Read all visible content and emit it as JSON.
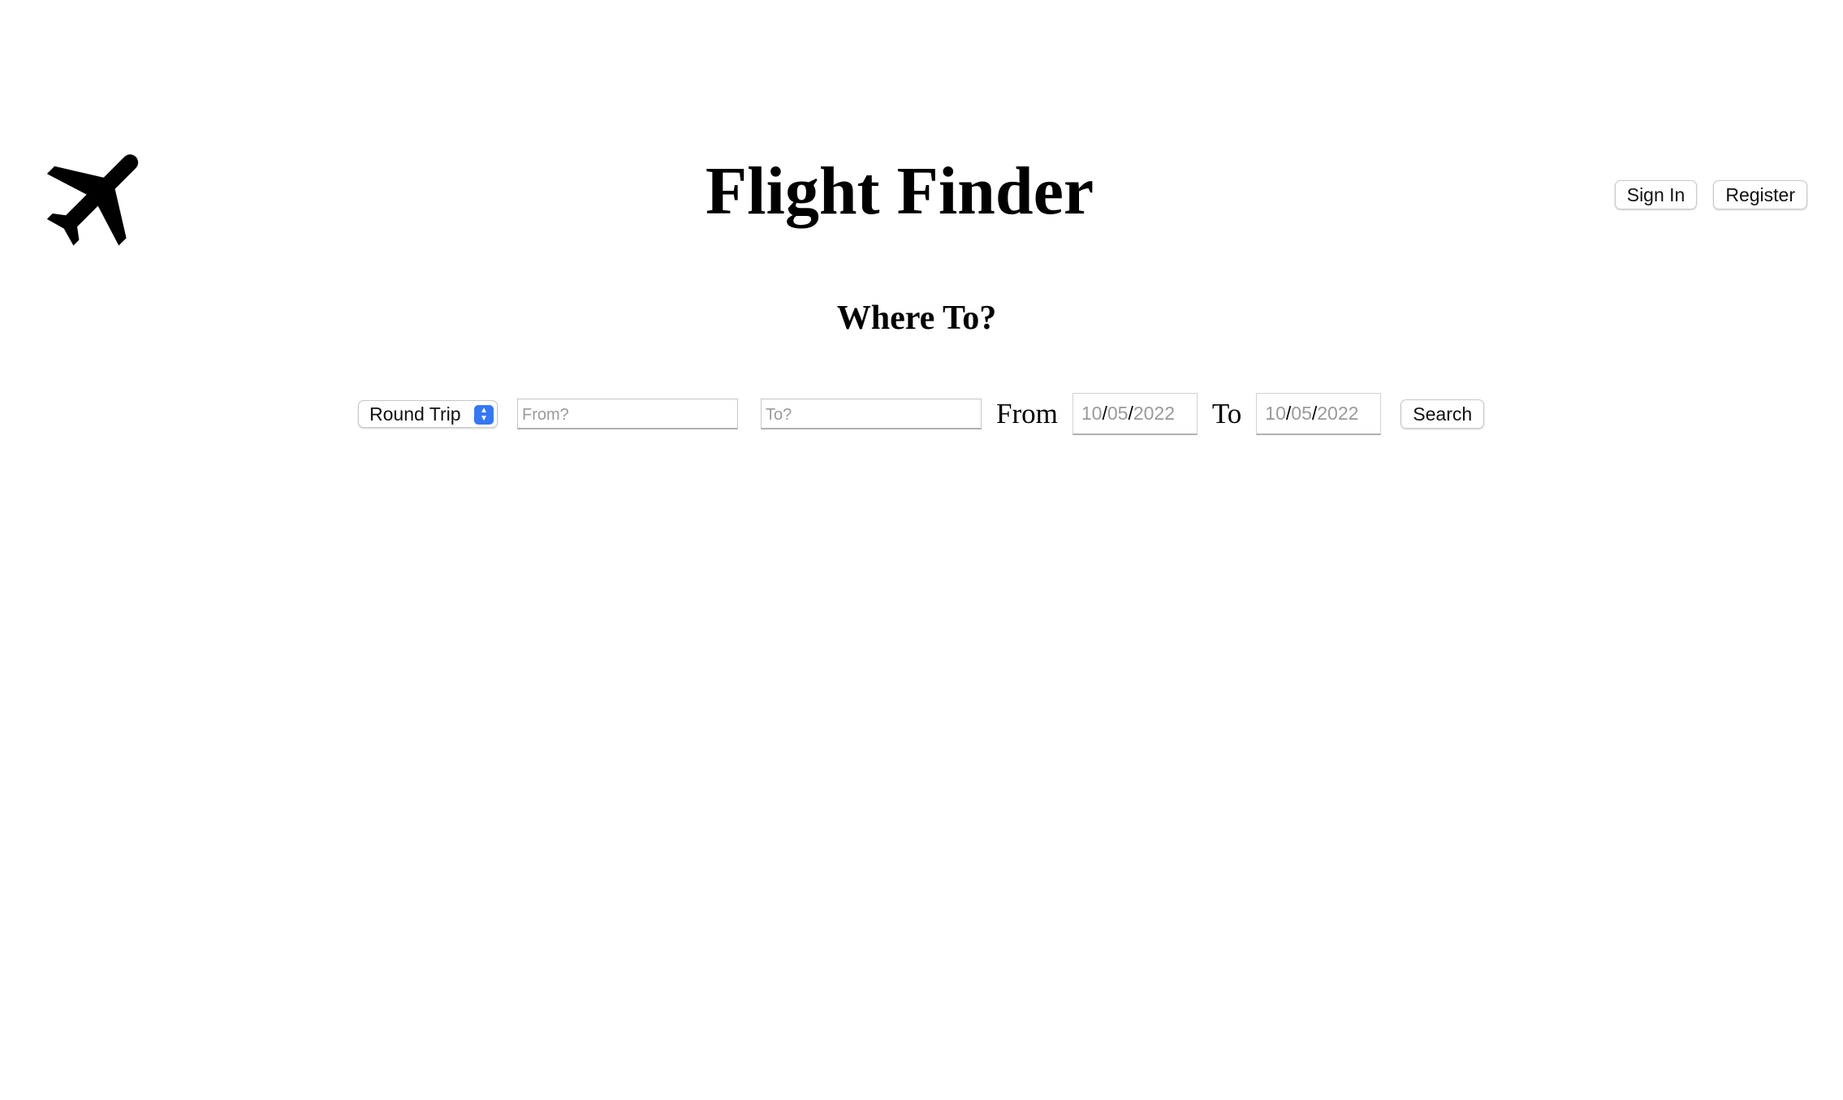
{
  "header": {
    "logo_icon": "airplane-icon",
    "title": "Flight Finder",
    "sign_in_label": "Sign In",
    "register_label": "Register"
  },
  "main": {
    "subtitle": "Where To?"
  },
  "search": {
    "trip_type": "Round Trip",
    "from_placeholder": "From?",
    "to_placeholder": "To?",
    "from_label": "From",
    "to_label": "To",
    "from_date": {
      "month": "10",
      "day": "05",
      "year": "2022"
    },
    "to_date": {
      "month": "10",
      "day": "05",
      "year": "2022"
    },
    "search_label": "Search"
  },
  "colors": {
    "select_accent": "#3478f6",
    "placeholder": "#9a9a9a"
  }
}
